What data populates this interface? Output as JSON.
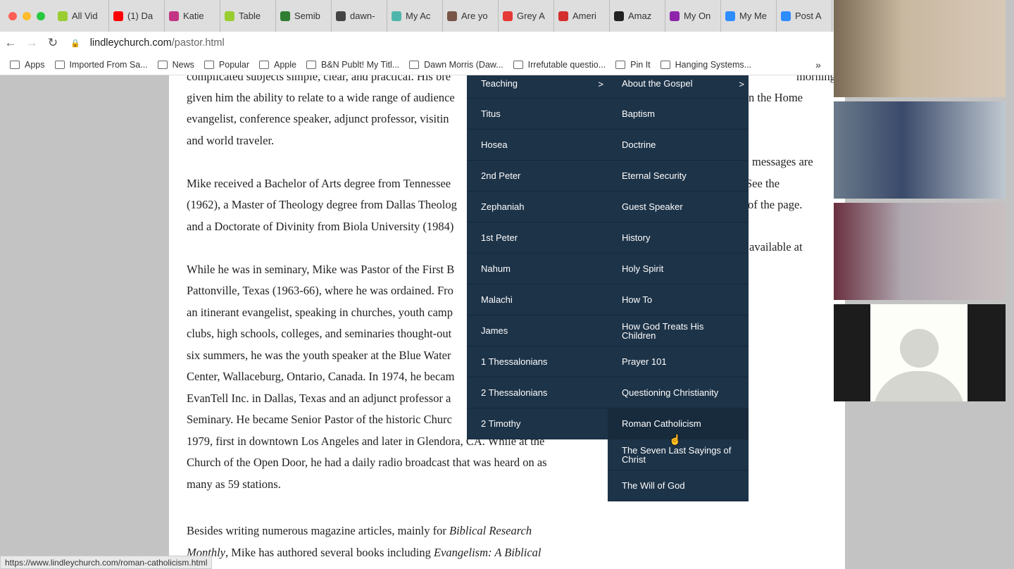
{
  "browser": {
    "tabs": [
      "All Vid",
      "(1) Da",
      "Katie",
      "Table",
      "Semib",
      "dawn-",
      "My Ac",
      "Are yo",
      "Grey A",
      "Ameri",
      "Amaz",
      "My On",
      "My Me",
      "Post A"
    ],
    "tab_colors": [
      "#9acd32",
      "#ff0000",
      "#c13584",
      "#9acd32",
      "#2e7d32",
      "#444",
      "#4db6ac",
      "#795548",
      "#e53935",
      "#d32f2f",
      "#222",
      "#8e24aa",
      "#2d8cff",
      "#2d8cff"
    ],
    "url_host": "lindleychurch.com",
    "url_path": "/pastor.html",
    "bookmarks": [
      "Apps",
      "Imported From Sa...",
      "News",
      "Popular",
      "Apple",
      "B&N Publt! My Titl...",
      "Dawn Morris (Daw...",
      "Irrefutable questio...",
      "Pin It",
      "Hanging Systems..."
    ],
    "more": "»",
    "status_url": "https://www.lindleychurch.com/roman-catholicism.html"
  },
  "article": {
    "left_lines": [
      "complicated subjects simple, clear, and practical. His bre",
      "given him the ability to relate to a wide range of audience",
      "evangelist, conference speaker, adjunct professor, visitin",
      "and world traveler.",
      "Mike received a Bachelor of Arts degree from Tennessee",
      "(1962), a Master of Theology degree from Dallas Theolog",
      "and a Doctorate of Divinity from Biola University (1984)",
      "While he was in seminary, Mike was Pastor of the First B",
      "Pattonville, Texas (1963-66), where he was ordained. Fro",
      "an itinerant evangelist, speaking in churches, youth camp",
      "clubs, high schools, colleges, and seminaries thought-out",
      "six summers, he was the youth speaker at the Blue Water",
      "Center, Wallaceburg, Ontario, Canada. In 1974, he becam",
      "EvanTell Inc. in Dallas, Texas and an adjunct professor a",
      "Seminary. He became Senior Pastor of the historic Churc",
      "1979, first in downtown Los Angeles and later in Glendora, CA. While at the",
      "Church of the Open Door, he had a daily radio broadcast that was heard on as",
      "many as 59 stations."
    ],
    "right_lines": [
      "morning. See",
      "n the Home",
      "messages are",
      "See the",
      "of the page.",
      "available at"
    ],
    "p4_a": "Besides writing numerous magazine articles, mainly for ",
    "p4_b": "Biblical Research",
    "p4_c": "Monthly",
    "p4_d": ", Mike has authored several books including ",
    "p4_e": "Evangelism: A Biblical"
  },
  "menu": {
    "col1": [
      "Teaching",
      "Titus",
      "Hosea",
      "2nd Peter",
      "Zephaniah",
      "1st Peter",
      "Nahum",
      "Malachi",
      "James",
      "1 Thessalonians",
      "2 Thessalonians",
      "2 Timothy"
    ],
    "col2": [
      "About the Gospel",
      "Baptism",
      "Doctrine",
      "Eternal Security",
      "Guest Speaker",
      "History",
      "Holy Spirit",
      "How To",
      "How God Treats His Children",
      "Prayer 101",
      "Questioning Christianity",
      "Roman Catholicism",
      "The Seven Last Sayings of Christ",
      "The Will of God"
    ],
    "submenu_arrow": ">",
    "hovered": "Roman Catholicism",
    "bg_color": "#1d3348"
  }
}
